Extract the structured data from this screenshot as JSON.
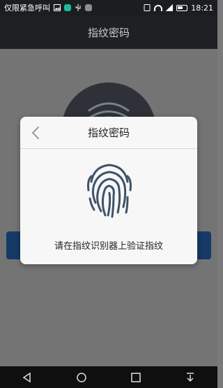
{
  "status_bar": {
    "carrier": "仅限紧急呼叫",
    "time": "18:21",
    "icons": [
      "app-icon",
      "app-icon",
      "usb-icon",
      "sim-icon",
      "wifi-icon",
      "signal-icon",
      "battery-icon"
    ]
  },
  "title_bar": {
    "title": "指纹密码"
  },
  "dialog": {
    "title": "指纹密码",
    "message": "请在指纹识别器上验证指纹",
    "back_icon": "chevron-left-icon",
    "fingerprint_icon": "fingerprint-icon",
    "fingerprint_color": "#3e5368"
  },
  "nav_bar": {
    "icons": [
      "back-icon",
      "home-icon",
      "recent-apps-icon",
      "notification-pull-icon"
    ]
  }
}
